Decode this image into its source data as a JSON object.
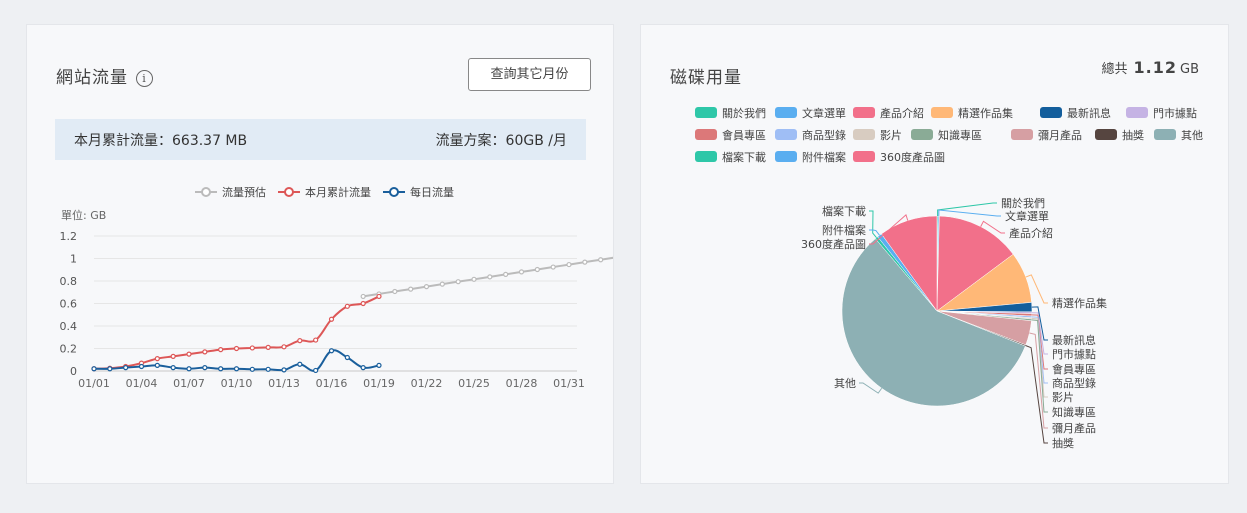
{
  "traffic": {
    "title": "網站流量",
    "info_icon": "i",
    "button_label": "查詢其它月份",
    "summary_left": "本月累計流量：663.37 MB",
    "summary_right": "流量方案：60GB /月"
  },
  "disk": {
    "title": "磁碟用量",
    "total_label": "總共",
    "total_value": "1.12",
    "total_unit": "GB"
  },
  "chart_data": [
    {
      "type": "line",
      "unit_label": "單位: GB",
      "ylim": [
        0,
        1.2
      ],
      "yticks": [
        "0",
        "0.2",
        "0.4",
        "0.6",
        "0.8",
        "1",
        "1.2"
      ],
      "xticks": [
        "01/01",
        "01/04",
        "01/07",
        "01/10",
        "01/13",
        "01/16",
        "01/19",
        "01/22",
        "01/25",
        "01/28",
        "01/31"
      ],
      "legend_position": "top-center",
      "grid": true,
      "series": [
        {
          "name": "流量預估",
          "color": "#bbbbbb",
          "start_day": 18,
          "values": [
            0.663,
            0.685,
            0.707,
            0.728,
            0.75,
            0.772,
            0.794,
            0.815,
            0.837,
            0.859,
            0.881,
            0.902,
            0.924,
            0.946,
            0.968,
            0.989,
            1.011,
            1.033,
            1.055
          ]
        },
        {
          "name": "本月累計流量",
          "color": "#dd5757",
          "start_day": 1,
          "values": [
            0.02,
            0.025,
            0.04,
            0.07,
            0.11,
            0.13,
            0.15,
            0.17,
            0.19,
            0.2,
            0.205,
            0.21,
            0.215,
            0.27,
            0.275,
            0.46,
            0.575,
            0.6,
            0.663
          ]
        },
        {
          "name": "每日流量",
          "color": "#1a5f9c",
          "start_day": 1,
          "values": [
            0.02,
            0.02,
            0.03,
            0.04,
            0.05,
            0.03,
            0.02,
            0.03,
            0.02,
            0.02,
            0.015,
            0.015,
            0.01,
            0.06,
            0.005,
            0.18,
            0.12,
            0.03,
            0.05
          ]
        }
      ]
    },
    {
      "type": "pie",
      "legend_position": "top",
      "slices": [
        {
          "label": "關於我們",
          "value": 0.2,
          "color": "#2ec7a8"
        },
        {
          "label": "文章選單",
          "value": 0.2,
          "color": "#5aaef0"
        },
        {
          "label": "產品介紹",
          "value": 14.5,
          "color": "#f2708a"
        },
        {
          "label": "精選作品集",
          "value": 8.8,
          "color": "#ffb877"
        },
        {
          "label": "最新訊息",
          "value": 1.6,
          "color": "#135e9c"
        },
        {
          "label": "門市據點",
          "value": 0.3,
          "color": "#c5b3e4"
        },
        {
          "label": "會員專區",
          "value": 0.4,
          "color": "#dc7879"
        },
        {
          "label": "商品型錄",
          "value": 0.3,
          "color": "#9fbef5"
        },
        {
          "label": "影片",
          "value": 0.2,
          "color": "#d8ccc1"
        },
        {
          "label": "知識專區",
          "value": 0.3,
          "color": "#8aab96"
        },
        {
          "label": "彌月產品",
          "value": 4.2,
          "color": "#d69fa3"
        },
        {
          "label": "抽獎",
          "value": 0.2,
          "color": "#564540"
        },
        {
          "label": "其他",
          "value": 58.1,
          "color": "#8db0b4"
        },
        {
          "label": "檔案下載",
          "value": 0.5,
          "color": "#2ec7a8"
        },
        {
          "label": "附件檔案",
          "value": 0.8,
          "color": "#5aaef0"
        },
        {
          "label": "360度產品圖",
          "value": 10.0,
          "color": "#f2708a"
        }
      ]
    }
  ]
}
